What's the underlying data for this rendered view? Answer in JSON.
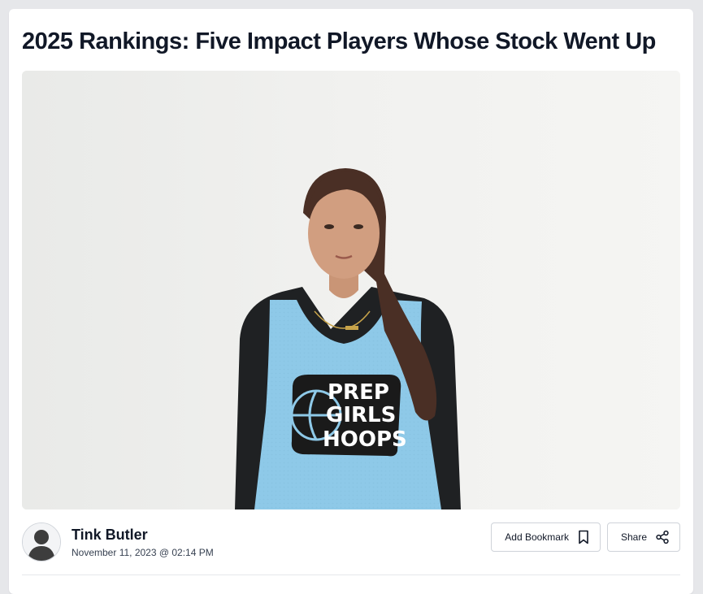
{
  "article": {
    "title": "2025 Rankings: Five Impact Players Whose Stock Went Up"
  },
  "hero": {
    "jersey_logo_lines": [
      "PREP",
      "GIRLS",
      "HOOPS"
    ]
  },
  "author": {
    "name": "Tink Butler",
    "date": "November 11, 2023 @ 02:14 PM"
  },
  "actions": {
    "bookmark_label": "Add Bookmark",
    "share_label": "Share",
    "bookmark_icon": "bookmark-icon",
    "share_icon": "share-icon"
  },
  "colors": {
    "jersey": "#8ec9e8",
    "background": "#e6e7ea"
  }
}
